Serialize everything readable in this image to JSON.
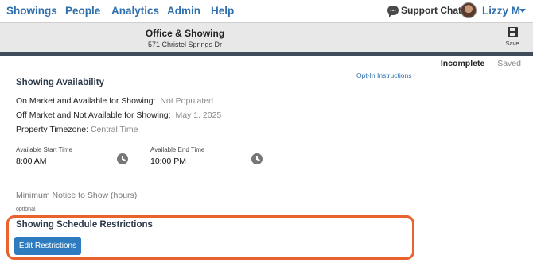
{
  "nav": {
    "items": [
      {
        "label": "Showings"
      },
      {
        "label": "People"
      },
      {
        "label": "Analytics"
      },
      {
        "label": "Admin"
      },
      {
        "label": "Help"
      }
    ],
    "support_label": "Support Chat",
    "user_name": "Lizzy M",
    "icons": {
      "support": "chat-bubble-icon",
      "user_menu": "caret-down-icon",
      "avatar": "user-avatar"
    }
  },
  "header": {
    "title": "Office & Showing",
    "address": "571 Christel Springs Dr",
    "save_label": "Save",
    "save_icon": "floppy-disk-icon"
  },
  "status": {
    "active": "Incomplete",
    "inactive": "Saved"
  },
  "availability": {
    "heading": "Showing Availability",
    "opt_in_link": "Opt-In Instructions",
    "rows": [
      {
        "label": "On Market and Available for Showing:",
        "value": "Not Populated"
      },
      {
        "label": "Off Market and Not Available for Showing:",
        "value": "May 1, 2025"
      },
      {
        "label": "Property Timezone:",
        "value": "Central Time"
      }
    ],
    "start_time": {
      "label": "Available Start Time",
      "value": "8:00 AM",
      "icon": "clock-icon"
    },
    "end_time": {
      "label": "Available End Time",
      "value": "10:00 PM",
      "icon": "clock-icon"
    },
    "min_notice": {
      "placeholder": "Minimum Notice to Show (hours)",
      "helper": "optional"
    }
  },
  "restrictions": {
    "heading": "Showing Schedule Restrictions",
    "button_label": "Edit Restrictions"
  },
  "colors": {
    "link_blue": "#2f6fae",
    "button_blue": "#2f7bbf",
    "highlight_orange": "#e8632e",
    "header_bar": "#3f4d5a"
  }
}
